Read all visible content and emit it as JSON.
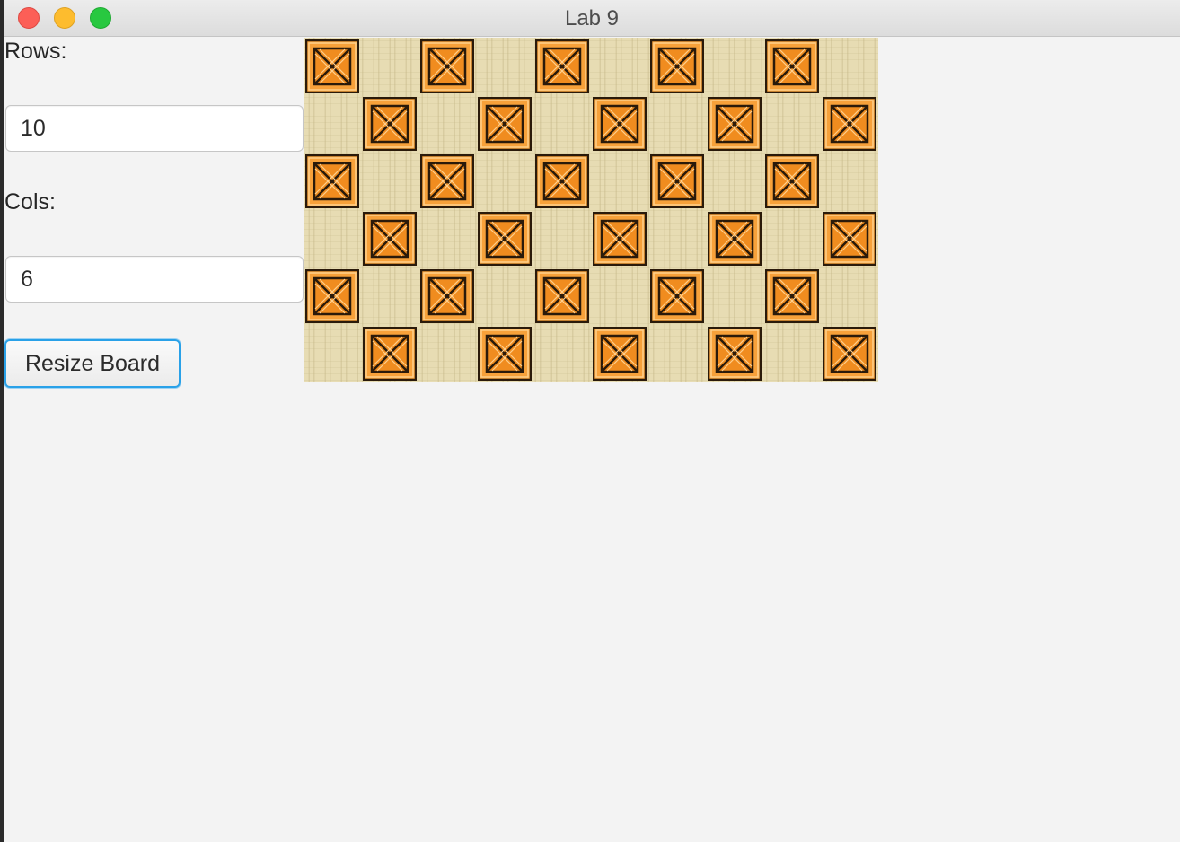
{
  "window": {
    "title": "Lab 9"
  },
  "form": {
    "rows_label": "Rows:",
    "rows_value": "10",
    "cols_label": "Cols:",
    "cols_value": "6",
    "resize_label": "Resize Board"
  },
  "board": {
    "columns": 10,
    "rows": 6,
    "tiles": [
      [
        "crate",
        "floor",
        "crate",
        "floor",
        "crate",
        "floor",
        "crate",
        "floor",
        "crate",
        "floor"
      ],
      [
        "floor",
        "crate",
        "floor",
        "crate",
        "floor",
        "crate",
        "floor",
        "crate",
        "floor",
        "crate"
      ],
      [
        "crate",
        "floor",
        "crate",
        "floor",
        "crate",
        "floor",
        "crate",
        "floor",
        "crate",
        "floor"
      ],
      [
        "floor",
        "crate",
        "floor",
        "crate",
        "floor",
        "crate",
        "floor",
        "crate",
        "floor",
        "crate"
      ],
      [
        "crate",
        "floor",
        "crate",
        "floor",
        "crate",
        "floor",
        "crate",
        "floor",
        "crate",
        "floor"
      ],
      [
        "floor",
        "crate",
        "floor",
        "crate",
        "floor",
        "crate",
        "floor",
        "crate",
        "floor",
        "crate"
      ]
    ],
    "floor_icon": "sand-floor-tile",
    "crate_icon": "wooden-crate-icon"
  },
  "colors": {
    "floor": "#e7dcb3",
    "crate_fill": "#f7a13a",
    "crate_outline": "#2a1a0a",
    "focus_ring": "#29a1e8",
    "close_button": "#fc5f57",
    "minimize_button": "#fdbc2e",
    "maximize_button": "#28c840"
  }
}
